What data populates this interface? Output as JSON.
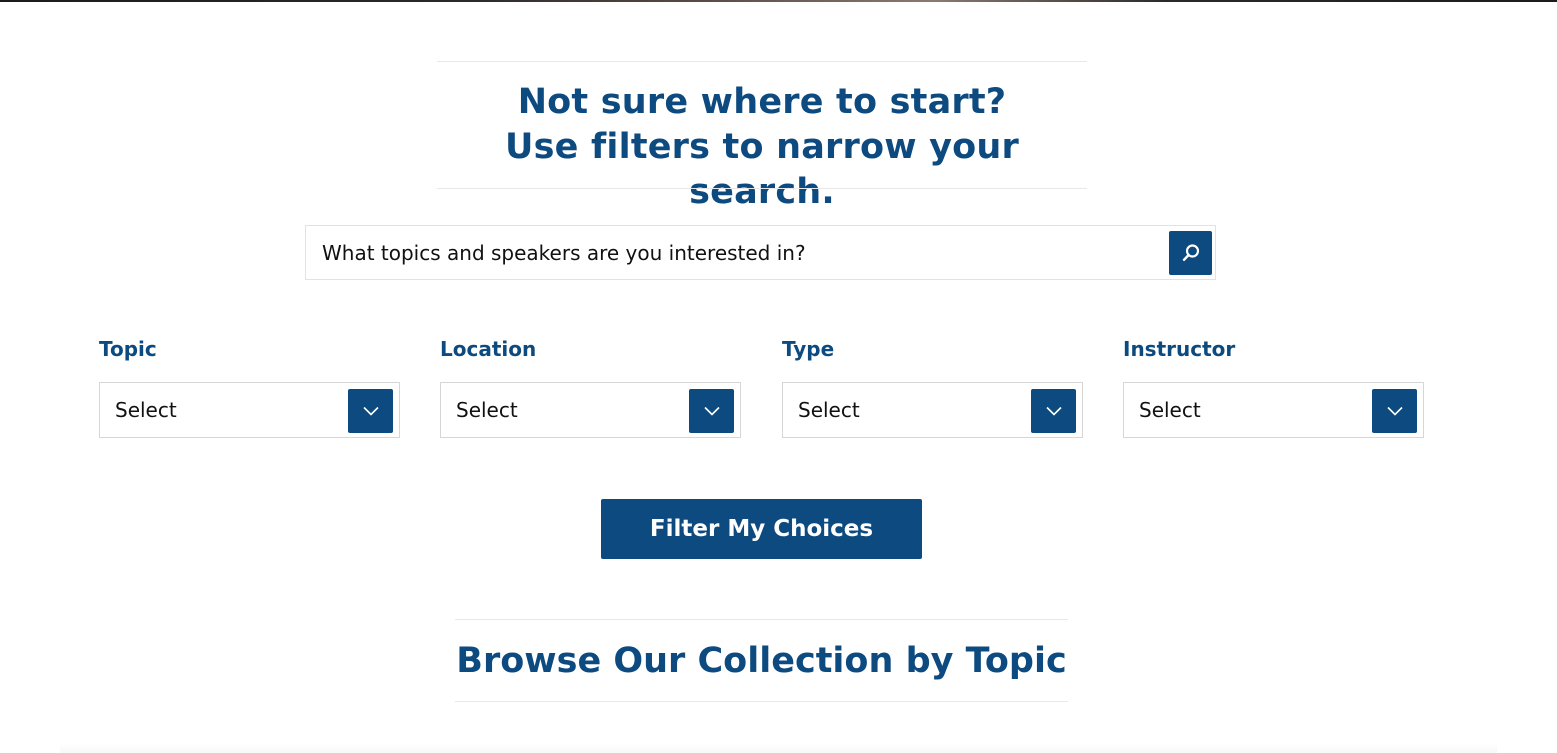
{
  "hero": {
    "title_line1": "Not sure where to start?",
    "title_line2": "Use filters to narrow your search."
  },
  "search": {
    "placeholder": "What topics and speakers are you interested in?",
    "button_icon": "search-icon"
  },
  "filters": [
    {
      "label": "Topic",
      "value": "Select",
      "icon": "chevron-down-icon"
    },
    {
      "label": "Location",
      "value": "Select",
      "icon": "chevron-down-icon"
    },
    {
      "label": "Type",
      "value": "Select",
      "icon": "chevron-down-icon"
    },
    {
      "label": "Instructor",
      "value": "Select",
      "icon": "chevron-down-icon"
    }
  ],
  "filter_button": {
    "label": "Filter My Choices"
  },
  "browse": {
    "title": "Browse Our Collection by Topic"
  },
  "colors": {
    "brand": "#0d4a80",
    "text": "#111111",
    "border": "#d6d6d6",
    "rule": "#e8e8e8"
  }
}
